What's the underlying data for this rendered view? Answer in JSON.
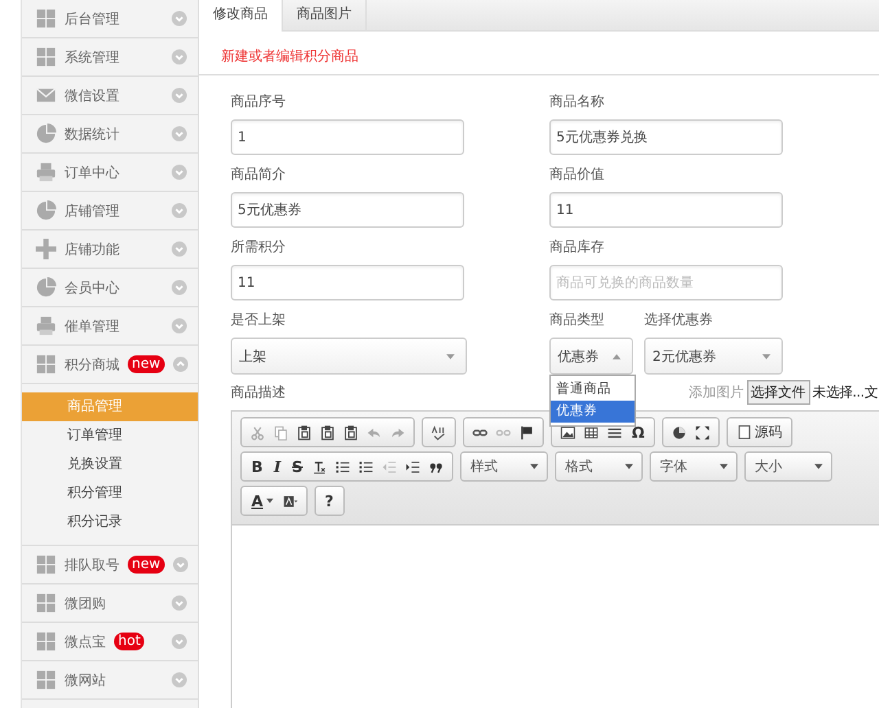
{
  "sidebar": {
    "items": [
      {
        "label": "后台管理",
        "kind": "grid"
      },
      {
        "label": "系统管理",
        "kind": "grid"
      },
      {
        "label": "微信设置",
        "kind": "mail"
      },
      {
        "label": "数据统计",
        "kind": "pie"
      },
      {
        "label": "订单中心",
        "kind": "printer"
      },
      {
        "label": "店铺管理",
        "kind": "pie"
      },
      {
        "label": "店铺功能",
        "kind": "plus"
      },
      {
        "label": "会员中心",
        "kind": "pie"
      },
      {
        "label": "催单管理",
        "kind": "printer"
      },
      {
        "label": "积分商城",
        "kind": "grid",
        "badge": "new",
        "expanded": true,
        "children": [
          {
            "label": "商品管理",
            "selected": true
          },
          {
            "label": "订单管理",
            "selected": false
          },
          {
            "label": "兑换设置",
            "selected": false
          },
          {
            "label": "积分管理",
            "selected": false
          },
          {
            "label": "积分记录",
            "selected": false
          }
        ]
      },
      {
        "label": "排队取号",
        "kind": "grid",
        "badge": "new"
      },
      {
        "label": "微团购",
        "kind": "grid"
      },
      {
        "label": "微点宝",
        "kind": "grid",
        "badge": "hot"
      },
      {
        "label": "微网站",
        "kind": "grid"
      }
    ]
  },
  "tabs": [
    {
      "label": "修改商品",
      "selected": true
    },
    {
      "label": "商品图片",
      "selected": false
    }
  ],
  "notice": "新建或者编辑积分商品",
  "fields": [
    {
      "label": "商品序号",
      "value": "1"
    },
    {
      "label": "商品名称",
      "value": "5元优惠券兑换"
    },
    {
      "label": "商品简介",
      "value": "5元优惠券"
    },
    {
      "label": "商品价值",
      "value": "11"
    },
    {
      "label": "所需积分",
      "value": "11"
    },
    {
      "label": "商品库存",
      "placeholder": "商品可兑换的商品数量"
    }
  ],
  "on_shelf": {
    "label": "是否上架",
    "value": "上架"
  },
  "product_type": {
    "label": "商品类型",
    "value": "优惠券",
    "expanded": true,
    "options": [
      {
        "label": "普通商品",
        "selected": false
      },
      {
        "label": "优惠券",
        "selected": true
      }
    ]
  },
  "coupon": {
    "label": "选择优惠券",
    "value": "2元优惠券"
  },
  "description": {
    "label": "商品描述",
    "add_image": "添加图片",
    "file_button": "选择文件",
    "file_status": "未选择...文"
  },
  "editor": {
    "toolbar": [
      [
        [
          {
            "kind": "cut"
          },
          {
            "kind": "copy"
          },
          {
            "kind": "paste"
          },
          {
            "kind": "paste"
          },
          {
            "kind": "paste"
          },
          {
            "kind": "undo"
          },
          {
            "kind": "redo"
          }
        ],
        [
          {
            "kind": "spell"
          }
        ],
        [
          {
            "kind": "link"
          },
          {
            "kind": "unlink"
          },
          {
            "kind": "flag"
          }
        ],
        [
          {
            "kind": "image"
          },
          {
            "kind": "table"
          },
          {
            "kind": "rule"
          },
          {
            "kind": "text",
            "label": "Ω"
          }
        ],
        [
          {
            "kind": "preview"
          },
          {
            "kind": "maximize"
          }
        ],
        [
          {
            "kind": "source",
            "label": "源码"
          }
        ]
      ],
      [
        [
          {
            "kind": "text",
            "label": "B"
          },
          {
            "kind": "italic",
            "label": "I"
          },
          {
            "kind": "strike",
            "label": "S"
          },
          {
            "kind": "clear"
          },
          {
            "kind": "olist"
          },
          {
            "kind": "ulist"
          },
          {
            "kind": "outdent"
          },
          {
            "kind": "indent"
          },
          {
            "kind": "quote"
          }
        ],
        [
          {
            "kind": "combo",
            "label": "样式"
          }
        ],
        [
          {
            "kind": "combo",
            "label": "格式"
          }
        ],
        [
          {
            "kind": "combo",
            "label": "字体"
          }
        ],
        [
          {
            "kind": "combo",
            "label": "大小"
          }
        ]
      ],
      [
        [
          {
            "kind": "color",
            "label": "A"
          },
          {
            "kind": "bgcolor"
          }
        ],
        [
          {
            "kind": "text",
            "label": "?"
          }
        ]
      ]
    ]
  }
}
